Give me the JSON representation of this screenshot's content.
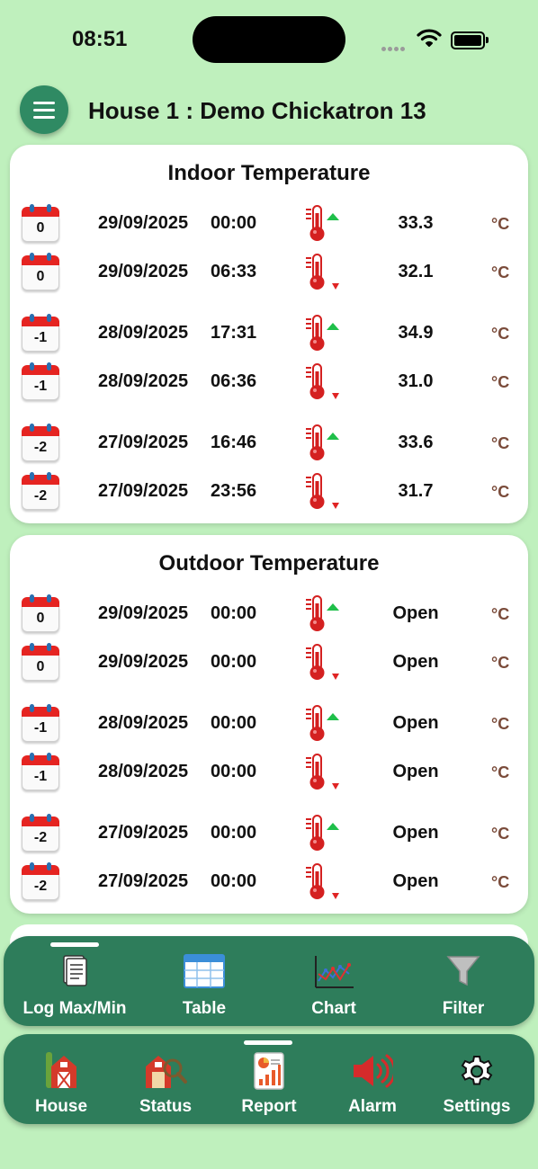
{
  "status_bar": {
    "time": "08:51"
  },
  "header": {
    "title": "House 1 : Demo Chickatron 13"
  },
  "indoor": {
    "title": "Indoor Temperature",
    "rows": [
      {
        "day": "0",
        "date": "29/09/2025",
        "time": "00:00",
        "trend": "up",
        "value": "33.3",
        "unit": "°C"
      },
      {
        "day": "0",
        "date": "29/09/2025",
        "time": "06:33",
        "trend": "down",
        "value": "32.1",
        "unit": "°C"
      },
      {
        "day": "-1",
        "date": "28/09/2025",
        "time": "17:31",
        "trend": "up",
        "value": "34.9",
        "unit": "°C"
      },
      {
        "day": "-1",
        "date": "28/09/2025",
        "time": "06:36",
        "trend": "down",
        "value": "31.0",
        "unit": "°C"
      },
      {
        "day": "-2",
        "date": "27/09/2025",
        "time": "16:46",
        "trend": "up",
        "value": "33.6",
        "unit": "°C"
      },
      {
        "day": "-2",
        "date": "27/09/2025",
        "time": "23:56",
        "trend": "down",
        "value": "31.7",
        "unit": "°C"
      }
    ]
  },
  "outdoor": {
    "title": "Outdoor Temperature",
    "rows": [
      {
        "day": "0",
        "date": "29/09/2025",
        "time": "00:00",
        "trend": "up",
        "value": "Open",
        "unit": "°C"
      },
      {
        "day": "0",
        "date": "29/09/2025",
        "time": "00:00",
        "trend": "down",
        "value": "Open",
        "unit": "°C"
      },
      {
        "day": "-1",
        "date": "28/09/2025",
        "time": "00:00",
        "trend": "up",
        "value": "Open",
        "unit": "°C"
      },
      {
        "day": "-1",
        "date": "28/09/2025",
        "time": "00:00",
        "trend": "down",
        "value": "Open",
        "unit": "°C"
      },
      {
        "day": "-2",
        "date": "27/09/2025",
        "time": "00:00",
        "trend": "up",
        "value": "Open",
        "unit": "°C"
      },
      {
        "day": "-2",
        "date": "27/09/2025",
        "time": "00:00",
        "trend": "down",
        "value": "Open",
        "unit": "°C"
      }
    ]
  },
  "sub_nav": {
    "selected": "log",
    "items": [
      {
        "id": "log",
        "label": "Log Max/Min",
        "icon": "log-document-icon"
      },
      {
        "id": "table",
        "label": "Table",
        "icon": "table-icon"
      },
      {
        "id": "chart",
        "label": "Chart",
        "icon": "line-chart-icon"
      },
      {
        "id": "filter",
        "label": "Filter",
        "icon": "filter-funnel-icon"
      }
    ]
  },
  "bottom_nav": {
    "selected": "report",
    "items": [
      {
        "id": "house",
        "label": "House",
        "icon": "barn-house-icon"
      },
      {
        "id": "status",
        "label": "Status",
        "icon": "barn-status-icon"
      },
      {
        "id": "report",
        "label": "Report",
        "icon": "report-icon"
      },
      {
        "id": "alarm",
        "label": "Alarm",
        "icon": "speaker-alarm-icon"
      },
      {
        "id": "settings",
        "label": "Settings",
        "icon": "gear-icon"
      }
    ]
  },
  "colors": {
    "background": "#bff0bd",
    "nav": "#2e7d5b",
    "up_arrow": "#1fbf4a",
    "down_arrow": "#e02424",
    "unit": "#7a4b3a"
  }
}
